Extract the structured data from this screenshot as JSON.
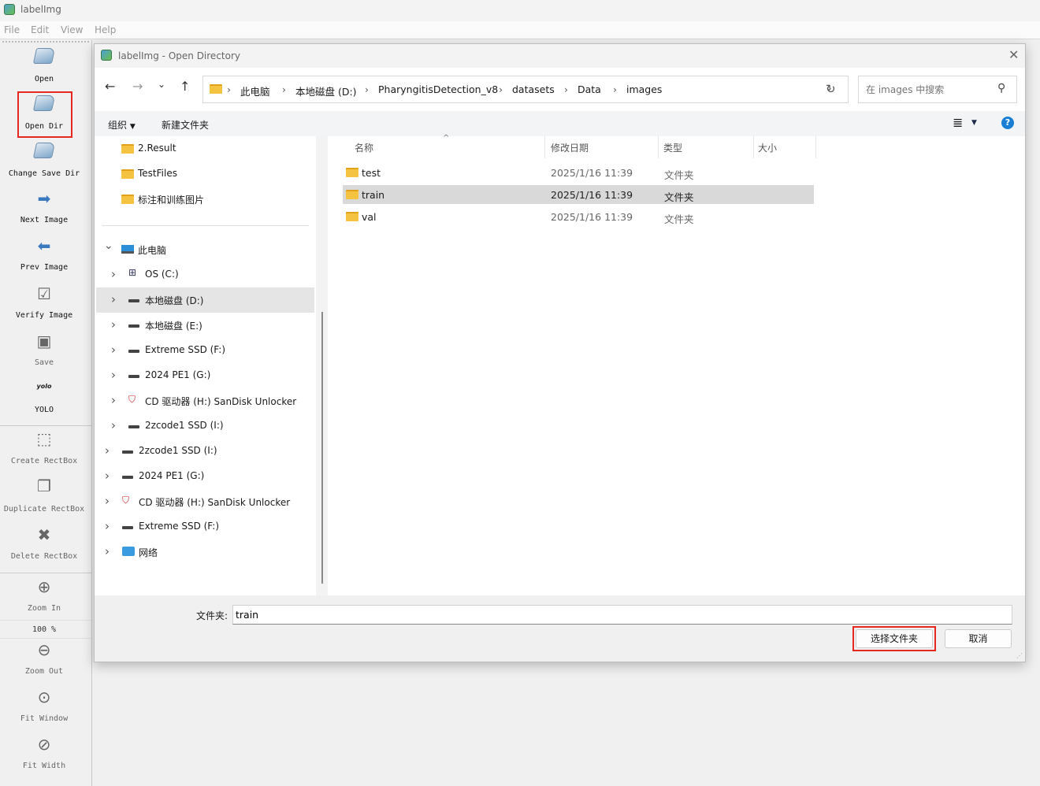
{
  "app": {
    "title": "labelImg"
  },
  "menu": [
    "File",
    "Edit",
    "View",
    "Help"
  ],
  "toolbar": {
    "items": [
      {
        "label": "Open",
        "icon": "folder-open-icon"
      },
      {
        "label": "Open Dir",
        "icon": "folder-open-icon"
      },
      {
        "label": "Change Save Dir",
        "icon": "folder-open-icon"
      },
      {
        "label": "Next Image",
        "icon": "arrow-right-icon"
      },
      {
        "label": "Prev Image",
        "icon": "arrow-left-icon"
      },
      {
        "label": "Verify Image",
        "icon": "checkbox-icon"
      },
      {
        "label": "Save",
        "icon": "save-icon"
      },
      {
        "label": "YOLO",
        "icon": "yolo-format-icon",
        "icon_text": "yolo"
      },
      {
        "label": "Create RectBox",
        "icon": "create-rectbox-icon"
      },
      {
        "label": "Duplicate RectBox",
        "icon": "duplicate-icon"
      },
      {
        "label": "Delete RectBox",
        "icon": "delete-icon"
      },
      {
        "label": "Zoom In",
        "icon": "zoom-in-icon"
      },
      {
        "label": "Zoom Out",
        "icon": "zoom-out-icon"
      },
      {
        "label": "Fit Window",
        "icon": "fit-window-icon"
      },
      {
        "label": "Fit Width",
        "icon": "fit-width-icon"
      }
    ],
    "zoom_level": "100 %"
  },
  "dialog": {
    "title": "labelImg - Open Directory",
    "breadcrumb": [
      "此电脑",
      "本地磁盘 (D:)",
      "PharyngitisDetection_v8",
      "datasets",
      "Data",
      "images"
    ],
    "search_placeholder": "在 images 中搜索",
    "organize_label": "组织",
    "new_folder_label": "新建文件夹",
    "quick_access": [
      "2.Result",
      "TestFiles",
      "标注和训练图片"
    ],
    "this_pc": "此电脑",
    "pc_drives": [
      "OS (C:)",
      "本地磁盘 (D:)",
      "本地磁盘 (E:)",
      "Extreme SSD (F:)",
      "2024 PE1 (G:)",
      "CD 驱动器 (H:) SanDisk Unlocker",
      "2zcode1 SSD (I:)"
    ],
    "top_drives": [
      "2zcode1 SSD (I:)",
      "2024 PE1 (G:)",
      "CD 驱动器 (H:) SanDisk Unlocker",
      "Extreme SSD (F:)"
    ],
    "network": "网络",
    "columns": [
      "名称",
      "修改日期",
      "类型",
      "大小"
    ],
    "files": [
      {
        "name": "test",
        "date": "2025/1/16 11:39",
        "type": "文件夹"
      },
      {
        "name": "train",
        "date": "2025/1/16 11:39",
        "type": "文件夹",
        "selected": true
      },
      {
        "name": "val",
        "date": "2025/1/16 11:39",
        "type": "文件夹"
      }
    ],
    "folder_label": "文件夹:",
    "folder_value": "train",
    "select_button": "选择文件夹",
    "cancel_button": "取消"
  },
  "colors": {
    "highlight": "#e8281e",
    "selected_row": "#d9d9d9",
    "help": "#1a7fd4"
  }
}
